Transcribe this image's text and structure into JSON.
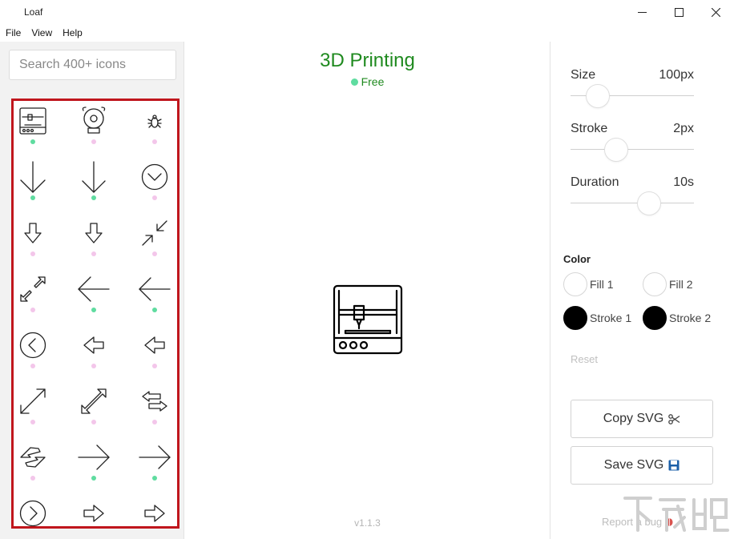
{
  "window": {
    "title": "Loaf",
    "controls": [
      "minimize-icon",
      "maximize-icon",
      "close-icon"
    ]
  },
  "menu": {
    "items": [
      "File",
      "View",
      "Help"
    ]
  },
  "sidebar": {
    "search_placeholder": "Search 400+ icons",
    "icons": [
      {
        "name": "3d-printer-icon",
        "tier": "free"
      },
      {
        "name": "alarm-bell-icon",
        "tier": "pro"
      },
      {
        "name": "bug-icon",
        "tier": "pro"
      },
      {
        "name": "arrow-down-long-icon",
        "tier": "free"
      },
      {
        "name": "arrow-down-thin-icon",
        "tier": "free"
      },
      {
        "name": "chevron-down-circle-icon",
        "tier": "pro"
      },
      {
        "name": "arrow-down-outline-icon",
        "tier": "pro"
      },
      {
        "name": "arrow-down-outline-small-icon",
        "tier": "pro"
      },
      {
        "name": "arrows-collapse-icon",
        "tier": "pro"
      },
      {
        "name": "arrows-expand-outline-icon",
        "tier": "pro"
      },
      {
        "name": "arrow-left-long-icon",
        "tier": "free"
      },
      {
        "name": "arrow-left-thin-icon",
        "tier": "free"
      },
      {
        "name": "chevron-left-circle-icon",
        "tier": "pro"
      },
      {
        "name": "arrow-left-outline-icon",
        "tier": "pro"
      },
      {
        "name": "arrow-left-outline-small-icon",
        "tier": "pro"
      },
      {
        "name": "arrows-diagonal-icon",
        "tier": "pro"
      },
      {
        "name": "arrows-diagonal-outline-icon",
        "tier": "pro"
      },
      {
        "name": "arrows-exchange-icon",
        "tier": "pro"
      },
      {
        "name": "arrows-exchange-diagonal-icon",
        "tier": "pro"
      },
      {
        "name": "arrow-right-long-icon",
        "tier": "free"
      },
      {
        "name": "arrow-right-thin-icon",
        "tier": "free"
      },
      {
        "name": "chevron-right-circle-icon",
        "tier": "pro"
      },
      {
        "name": "arrow-right-outline-icon",
        "tier": "pro"
      },
      {
        "name": "arrow-right-outline-small-icon",
        "tier": "pro"
      }
    ]
  },
  "main": {
    "icon_title": "3D Printing",
    "icon_badge": "Free",
    "preview_icon": "3d-printer-icon",
    "version": "v1.1.3"
  },
  "controls": {
    "size": {
      "label": "Size",
      "value": "100px",
      "level": 0.15
    },
    "stroke": {
      "label": "Stroke",
      "value": "2px",
      "level": 0.34
    },
    "duration": {
      "label": "Duration",
      "value": "10s",
      "level": 0.67
    },
    "color_heading": "Color",
    "fill1": {
      "label": "Fill 1",
      "color": "#ffffff"
    },
    "fill2": {
      "label": "Fill 2",
      "color": "#ffffff"
    },
    "stroke1": {
      "label": "Stroke 1",
      "color": "#000000"
    },
    "stroke2": {
      "label": "Stroke 2",
      "color": "#000000"
    },
    "reset_label": "Reset",
    "copy_label": "Copy SVG",
    "save_label": "Save SVG",
    "report_label": "Report a bug"
  },
  "theme": {
    "accent": "#1f8a1f",
    "free_dot": "#5fdca0",
    "pro_dot": "#f3c6ea",
    "highlight_border": "#c0161d"
  }
}
